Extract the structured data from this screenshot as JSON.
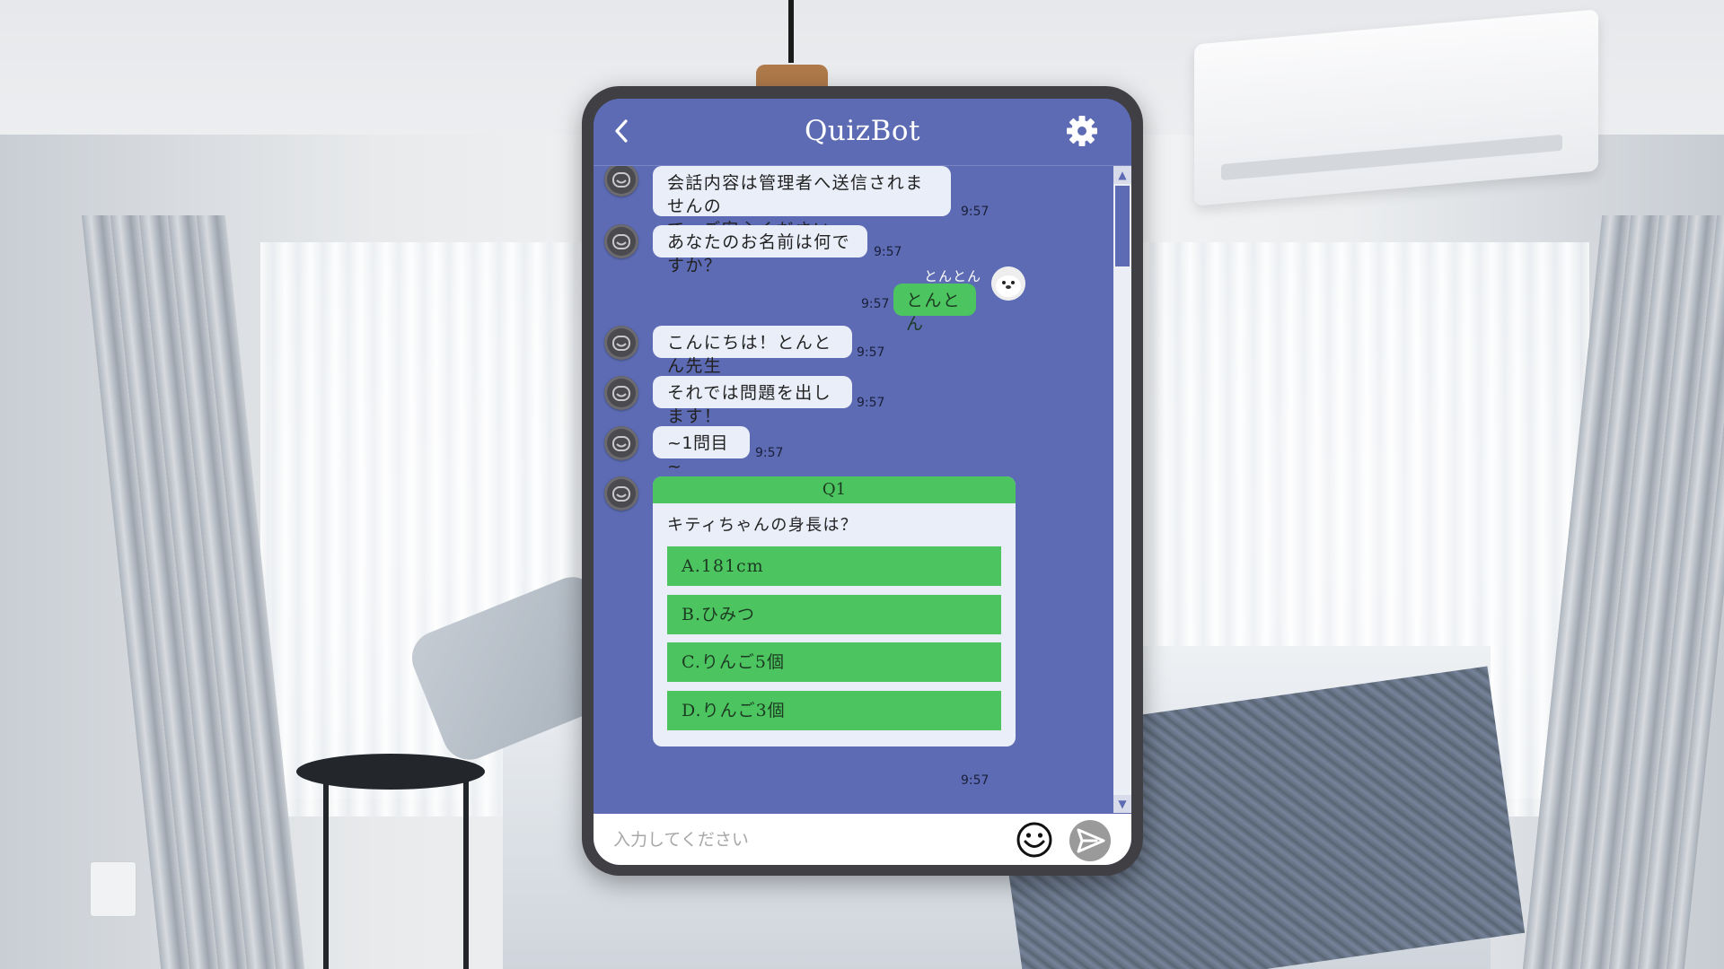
{
  "app": {
    "title": "QuizBot",
    "accent_color": "#5c6bb3",
    "user_bubble_color": "#4cc45f"
  },
  "messages": [
    {
      "sender": "bot",
      "text_lines": [
        "会話内容は管理者へ送信されませんの",
        "で、ご安心ください。"
      ],
      "time": "9:57"
    },
    {
      "sender": "bot",
      "text": "あなたのお名前は何ですか？",
      "time": "9:57"
    },
    {
      "sender": "user",
      "username": "とんとん",
      "text": "とんとん",
      "time": "9:57"
    },
    {
      "sender": "bot",
      "text": "こんにちは！とんとん先生",
      "time": "9:57"
    },
    {
      "sender": "bot",
      "text": "それでは問題を出します！",
      "time": "9:57"
    },
    {
      "sender": "bot",
      "text": "~1問目~",
      "time": "9:57"
    }
  ],
  "quiz": {
    "label": "Q1",
    "question": "キティちゃんの身長は？",
    "options": [
      "A.181cm",
      "B.ひみつ",
      "C.りんご5個",
      "D.りんご3個"
    ],
    "time": "9:57"
  },
  "input": {
    "placeholder": "入力してください",
    "value": ""
  },
  "icons": {
    "back": "chevron-left-icon",
    "settings": "gear-icon",
    "bot_avatar": "robot-icon",
    "user_avatar": "seal-avatar",
    "emoji": "smiley-icon",
    "send": "send-arrow-icon"
  }
}
